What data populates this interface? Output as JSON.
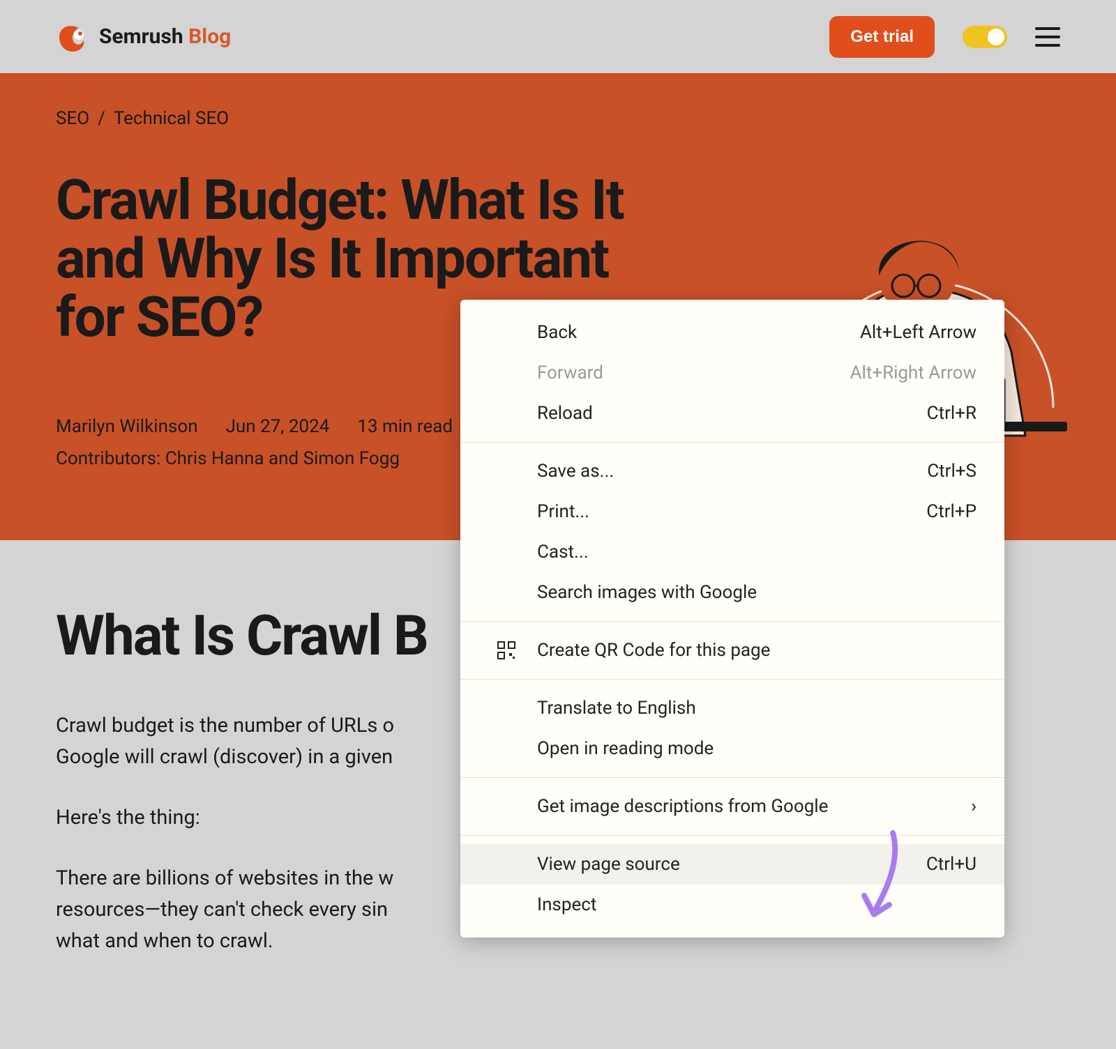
{
  "header": {
    "brand_name": "Semrush",
    "brand_suffix": "Blog",
    "cta_label": "Get trial"
  },
  "breadcrumb": {
    "items": [
      "SEO",
      "Technical SEO"
    ],
    "separator": "/"
  },
  "article": {
    "title": "Crawl Budget: What Is It and Why Is It Important for SEO?",
    "author": "Marilyn Wilkinson",
    "date": "Jun 27, 2024",
    "read_time": "13 min read",
    "contributors": "Contributors: Chris Hanna and Simon Fogg"
  },
  "content": {
    "heading": "What Is Crawl B",
    "p1": "Crawl budget is the number of URLs o",
    "p1b": "Google will crawl (discover) in a given",
    "p2": "Here's the thing:",
    "p3": "There are billions of websites in the w",
    "p3b": "resources—they can't check every sin",
    "p3c": "what and when to crawl."
  },
  "context_menu": {
    "items": [
      {
        "label": "Back",
        "shortcut": "Alt+Left Arrow",
        "disabled": false
      },
      {
        "label": "Forward",
        "shortcut": "Alt+Right Arrow",
        "disabled": true
      },
      {
        "label": "Reload",
        "shortcut": "Ctrl+R",
        "disabled": false
      }
    ],
    "group2": [
      {
        "label": "Save as...",
        "shortcut": "Ctrl+S"
      },
      {
        "label": "Print...",
        "shortcut": "Ctrl+P"
      },
      {
        "label": "Cast..."
      },
      {
        "label": "Search images with Google"
      }
    ],
    "group3": [
      {
        "label": "Create QR Code for this page",
        "icon": "qr"
      }
    ],
    "group4": [
      {
        "label": "Translate to English"
      },
      {
        "label": "Open in reading mode"
      }
    ],
    "group5": [
      {
        "label": "Get image descriptions from Google",
        "submenu": true
      }
    ],
    "group6": [
      {
        "label": "View page source",
        "shortcut": "Ctrl+U",
        "highlight": true
      },
      {
        "label": "Inspect"
      }
    ]
  },
  "colors": {
    "hero_bg": "#c85127",
    "page_bg": "#d4d4d4",
    "cta_bg": "#e04e1c",
    "toggle_bg": "#f0c420",
    "annotation": "#a87cf0"
  }
}
